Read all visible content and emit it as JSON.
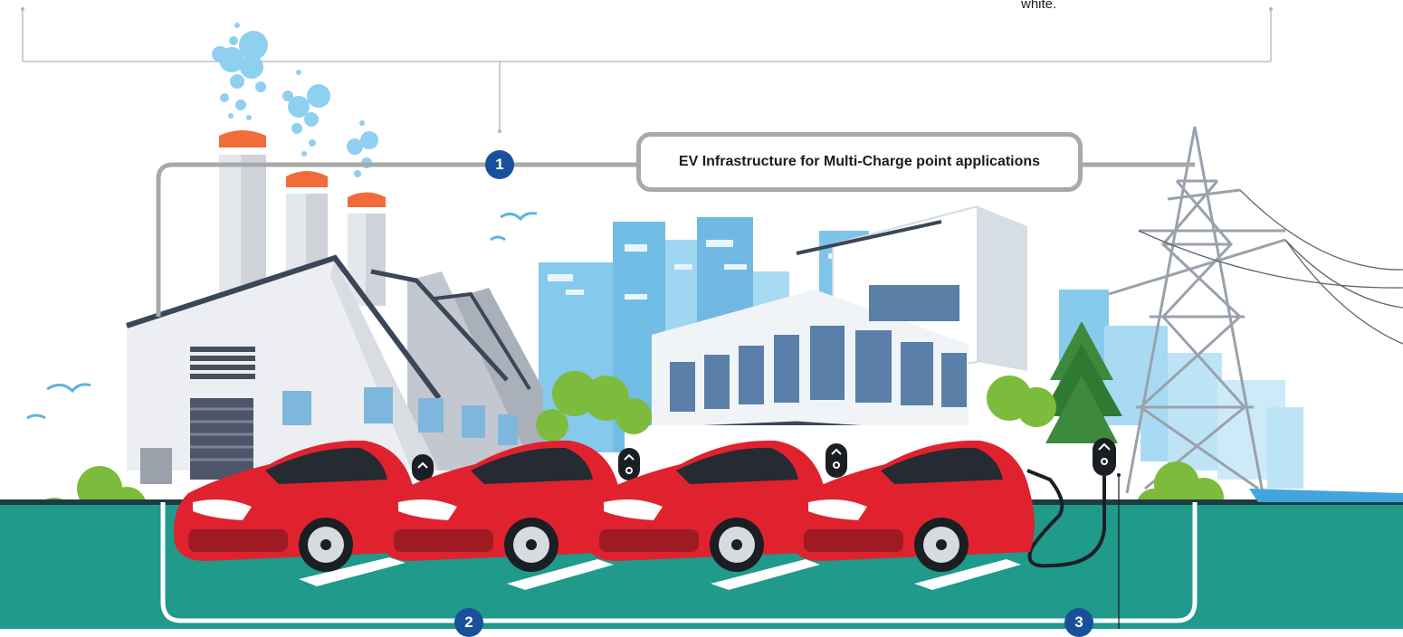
{
  "header": {
    "note_fragment": "white."
  },
  "callout": {
    "title": "EV Infrastructure for Multi-Charge point applications"
  },
  "markers": [
    "1",
    "2",
    "3"
  ],
  "colors": {
    "ground": "#1f9a8b",
    "ground_edge": "#1e3b44",
    "car_body": "#e0222f",
    "marker": "#1a4f9c",
    "connector_line": "#a9a9a9",
    "tree_green": "#7dbb3c",
    "building_blue": "#7fc6ea",
    "smoke": "#8fd0f1",
    "stack_cap": "#f26b3a",
    "pylon": "#9aa1ad"
  }
}
